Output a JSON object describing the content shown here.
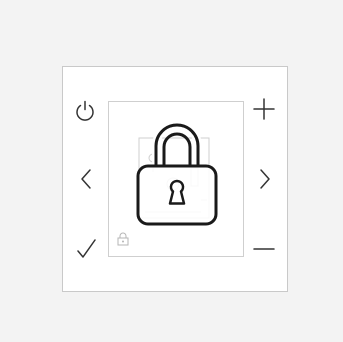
{
  "device": {
    "buttons": [
      {
        "name": "power-button",
        "icon": "power-icon"
      },
      {
        "name": "back-button",
        "icon": "chevron-left-icon"
      },
      {
        "name": "confirm-button",
        "icon": "checkmark-icon"
      },
      {
        "name": "increase-button",
        "icon": "plus-icon"
      },
      {
        "name": "next-button",
        "icon": "chevron-right-icon"
      },
      {
        "name": "decrease-button",
        "icon": "minus-icon"
      }
    ],
    "screen": {
      "state": "locked",
      "overlay_icon": "padlock-icon",
      "status_icon": "small-lock-icon"
    },
    "colors": {
      "background": "#f3f3f3",
      "device_face": "#ffffff",
      "icon_stroke": "#333333",
      "ghost_stroke": "#c8c8c8"
    }
  }
}
